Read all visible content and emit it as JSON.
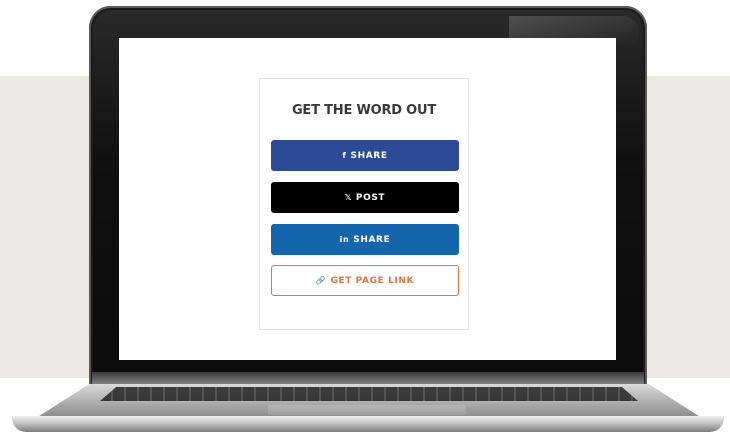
{
  "share_card": {
    "title": "GET THE WORD OUT",
    "buttons": {
      "facebook": {
        "icon": "f",
        "label": "SHARE",
        "icon_name": "facebook-icon",
        "color": "#2d4a94"
      },
      "x": {
        "icon": "𝕏",
        "label": "POST",
        "icon_name": "x-icon",
        "color": "#000000"
      },
      "linkedin": {
        "icon": "in",
        "label": "SHARE",
        "icon_name": "linkedin-icon",
        "color": "#1565ad"
      },
      "page_link": {
        "icon": "🔗",
        "label": "GET PAGE LINK",
        "icon_name": "link-icon",
        "color": "#e9733a"
      }
    }
  }
}
